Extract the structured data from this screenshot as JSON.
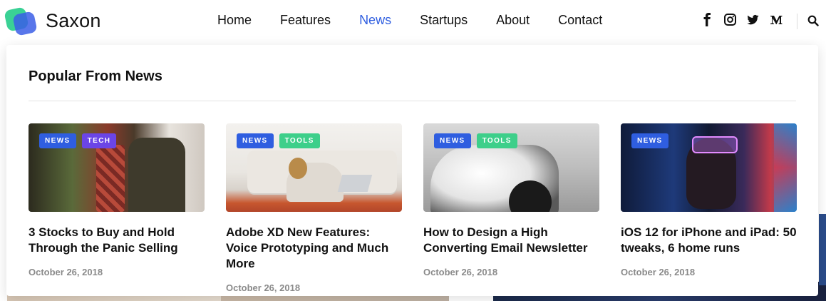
{
  "brand": {
    "name": "Saxon"
  },
  "nav": {
    "items": [
      "Home",
      "Features",
      "News",
      "Startups",
      "About",
      "Contact"
    ],
    "active": "News"
  },
  "social": [
    "facebook-icon",
    "instagram-icon",
    "twitter-icon",
    "medium-icon"
  ],
  "colors": {
    "accent": "#2f5ee0",
    "tech": "#6b45e6",
    "tools": "#3dcf8a"
  },
  "mega_menu": {
    "title": "Popular From News",
    "posts": [
      {
        "tags": [
          "NEWS",
          "TECH"
        ],
        "title": "3 Stocks to Buy and Hold Through the Panic Selling",
        "date": "October 26, 2018"
      },
      {
        "tags": [
          "NEWS",
          "TOOLS"
        ],
        "title": "Adobe XD New Features: Voice Prototyping and Much More",
        "date": "October 26, 2018"
      },
      {
        "tags": [
          "NEWS",
          "TOOLS"
        ],
        "title": "How to Design a High Converting Email Newsletter",
        "date": "October 26, 2018"
      },
      {
        "tags": [
          "NEWS"
        ],
        "title": "iOS 12 for iPhone and iPad: 50 tweaks, 6 home runs",
        "date": "October 26, 2018"
      }
    ]
  }
}
